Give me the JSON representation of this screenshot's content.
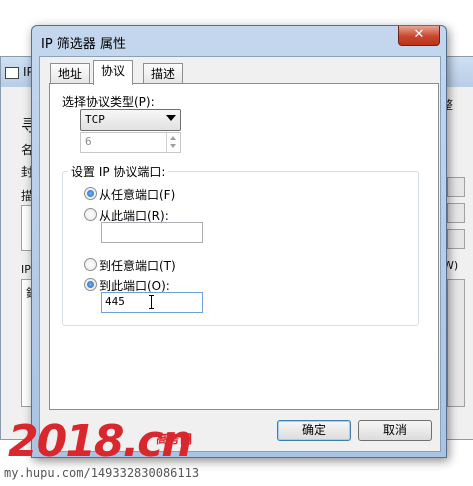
{
  "background_window": {
    "title_fragment": "IP",
    "right_fragment": "整",
    "left_fragments": [
      "寻",
      "名",
      "封",
      "描",
      "IP",
      "鎻"
    ],
    "right_side_fragment": "W)"
  },
  "dialog": {
    "title": "IP 筛选器 属性",
    "close_glyph": "✕",
    "tabs": [
      {
        "label": "地址",
        "active": false
      },
      {
        "label": "协议",
        "active": true
      },
      {
        "label": "描述",
        "active": false
      }
    ],
    "protocol_type_label": "选择协议类型(P):",
    "protocol_type_value": "TCP",
    "protocol_number_value": "6",
    "port_group_label": "设置 IP 协议端口:",
    "source": {
      "any_port_label": "从任意端口(F)",
      "this_port_label": "从此端口(R):",
      "selected": "any_port",
      "port_value": ""
    },
    "destination": {
      "any_port_label": "到任意端口(T)",
      "this_port_label": "到此端口(O):",
      "selected": "this_port",
      "port_value": "445"
    },
    "ok_label": "确定",
    "cancel_label": "取消"
  },
  "watermark": {
    "logo": "2018.cn",
    "subtitle": "高考网",
    "url": "my.hupu.com/149332830086113"
  },
  "colors": {
    "title_bar": "#b8cde6",
    "close_button": "#c8462c",
    "watermark": "#d9272e",
    "radio_dot": "#1b5fa8"
  }
}
